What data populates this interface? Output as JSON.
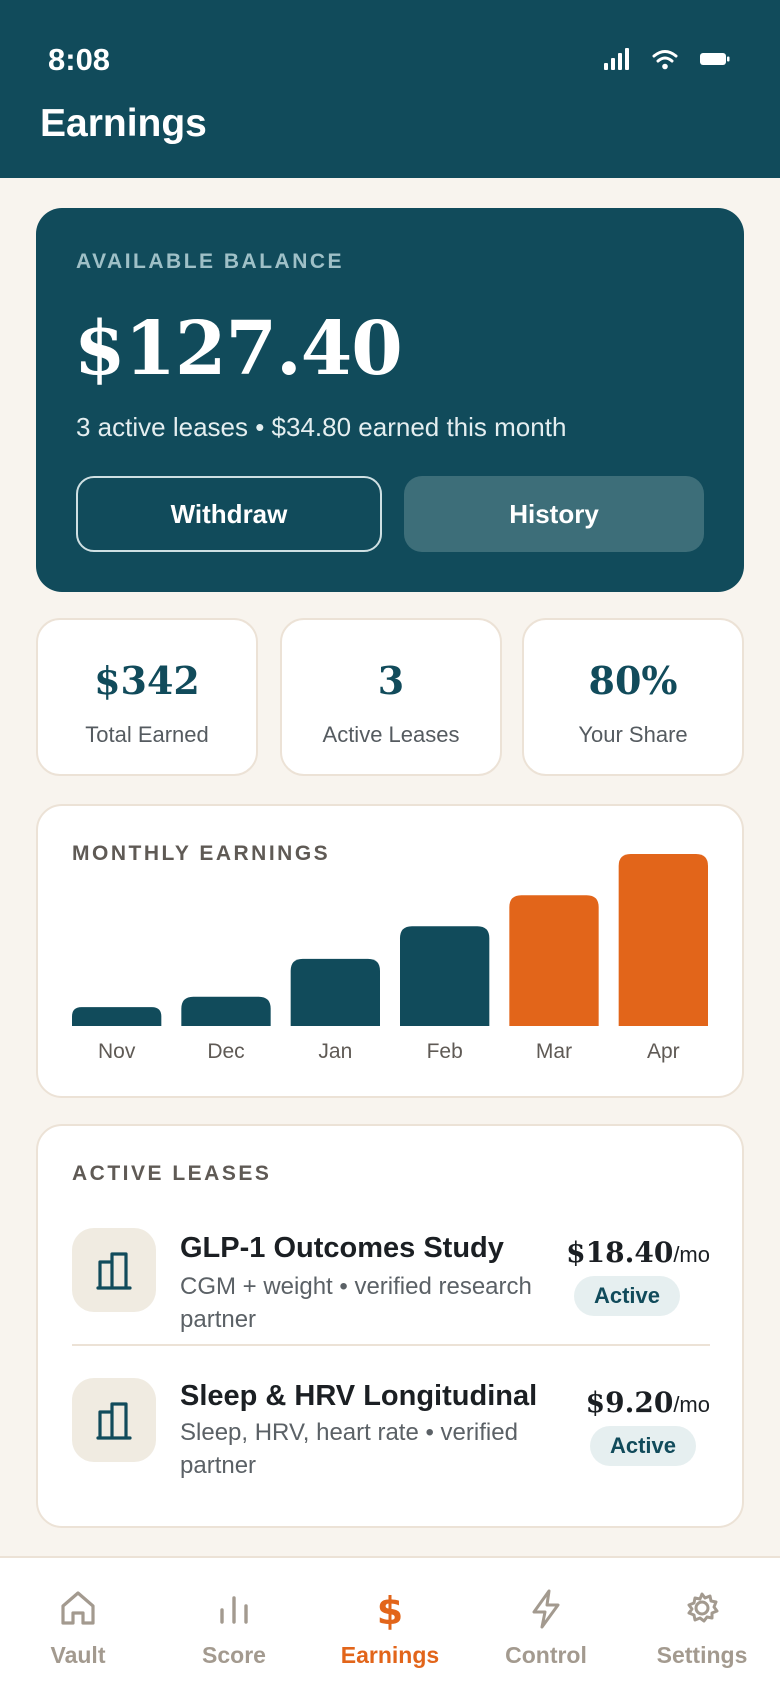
{
  "status_bar": {
    "time": "8:08"
  },
  "header": {
    "title": "Earnings"
  },
  "balance": {
    "label": "AVAILABLE BALANCE",
    "amount": "$127.40",
    "subtitle": "3 active leases • $34.80 earned this month",
    "withdraw_label": "Withdraw",
    "history_label": "History"
  },
  "stats": [
    {
      "value": "$342",
      "label": "Total Earned"
    },
    {
      "value": "3",
      "label": "Active Leases"
    },
    {
      "value": "80%",
      "label": "Your Share"
    }
  ],
  "chart": {
    "title": "MONTHLY EARNINGS"
  },
  "chart_data": {
    "type": "bar",
    "categories": [
      "Nov",
      "Dec",
      "Jan",
      "Feb",
      "Mar",
      "Apr"
    ],
    "values": [
      0.11,
      0.17,
      0.39,
      0.58,
      0.76,
      1.0
    ],
    "value_unit": "fraction of tallest bar",
    "highlighted": [
      false,
      false,
      false,
      false,
      true,
      true
    ],
    "colors": {
      "default": "#114b5b",
      "highlight": "#e2651a"
    },
    "title": "MONTHLY EARNINGS",
    "xlabel": "",
    "ylabel": ""
  },
  "leases": {
    "title": "ACTIVE LEASES",
    "items": [
      {
        "name": "GLP-1 Outcomes Study",
        "description": "CGM + weight • verified research partner",
        "price": "$18.40",
        "unit": "/mo",
        "status": "Active",
        "icon": "building-icon"
      },
      {
        "name": "Sleep & HRV Longitudinal",
        "description": "Sleep, HRV, heart rate • verified partner",
        "price": "$9.20",
        "unit": "/mo",
        "status": "Active",
        "icon": "building-icon"
      }
    ]
  },
  "nav": {
    "items": [
      {
        "label": "Vault",
        "icon": "home-icon",
        "active": false
      },
      {
        "label": "Score",
        "icon": "bar-chart-icon",
        "active": false
      },
      {
        "label": "Earnings",
        "icon": "dollar-icon",
        "active": true
      },
      {
        "label": "Control",
        "icon": "lightning-icon",
        "active": false
      },
      {
        "label": "Settings",
        "icon": "gear-icon",
        "active": false
      }
    ]
  },
  "colors": {
    "primary": "#114b5b",
    "accent": "#e2651a",
    "background": "#f8f4ee",
    "muted": "#a39a8f"
  }
}
